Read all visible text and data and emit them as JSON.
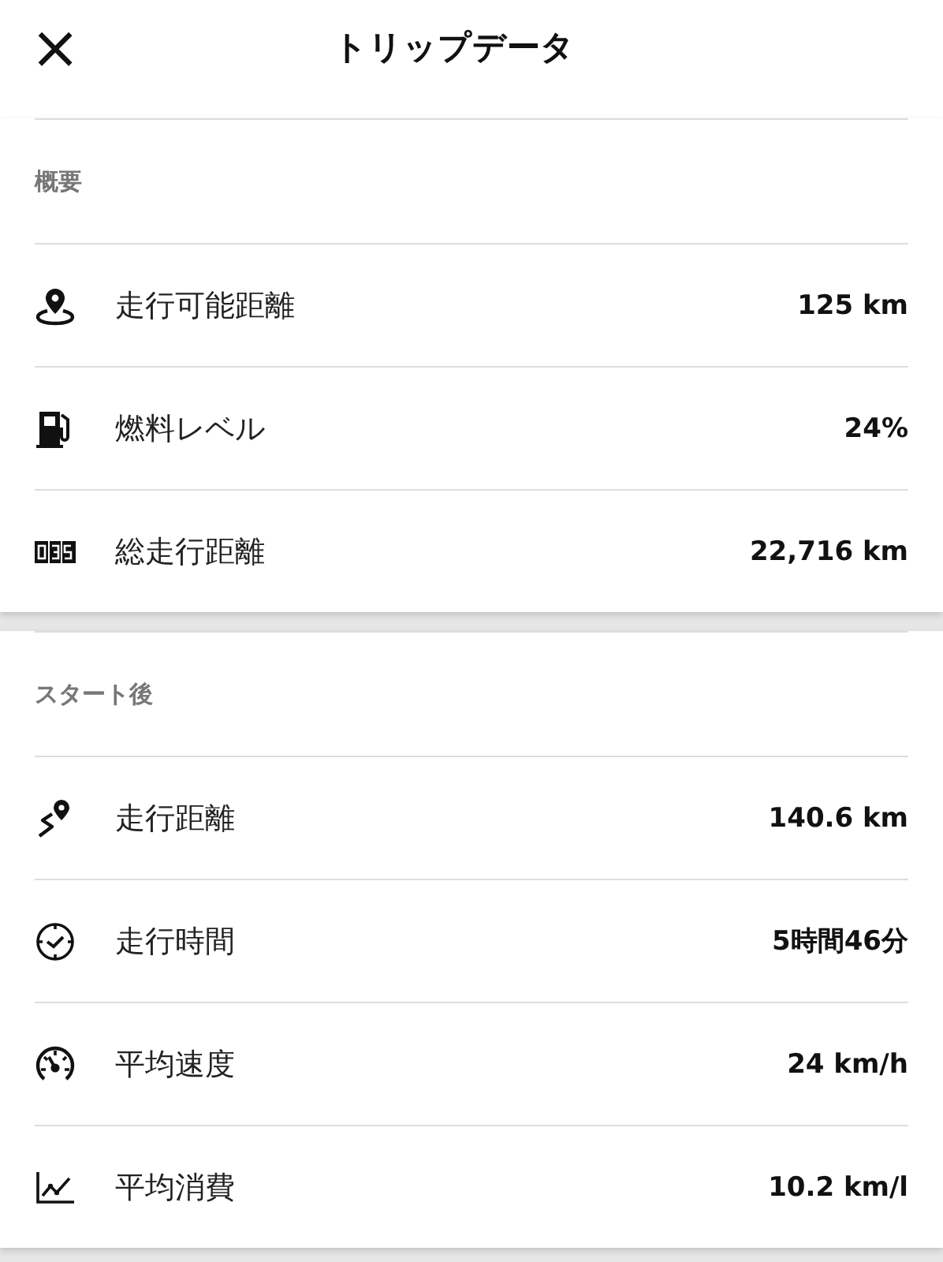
{
  "header": {
    "close": "×",
    "title": "トリップデータ"
  },
  "sections": [
    {
      "title": "概要",
      "rows": [
        {
          "label": "走行可能距離",
          "value": "125 km"
        },
        {
          "label": "燃料レベル",
          "value": "24%"
        },
        {
          "label": "総走行距離",
          "value": "22,716 km"
        }
      ]
    },
    {
      "title": "スタート後",
      "rows": [
        {
          "label": "走行距離",
          "value": "140.6 km"
        },
        {
          "label": "走行時間",
          "value": "5時間46分"
        },
        {
          "label": "平均速度",
          "value": "24 km/h"
        },
        {
          "label": "平均消費",
          "value": "10.2 km/l"
        }
      ]
    }
  ]
}
